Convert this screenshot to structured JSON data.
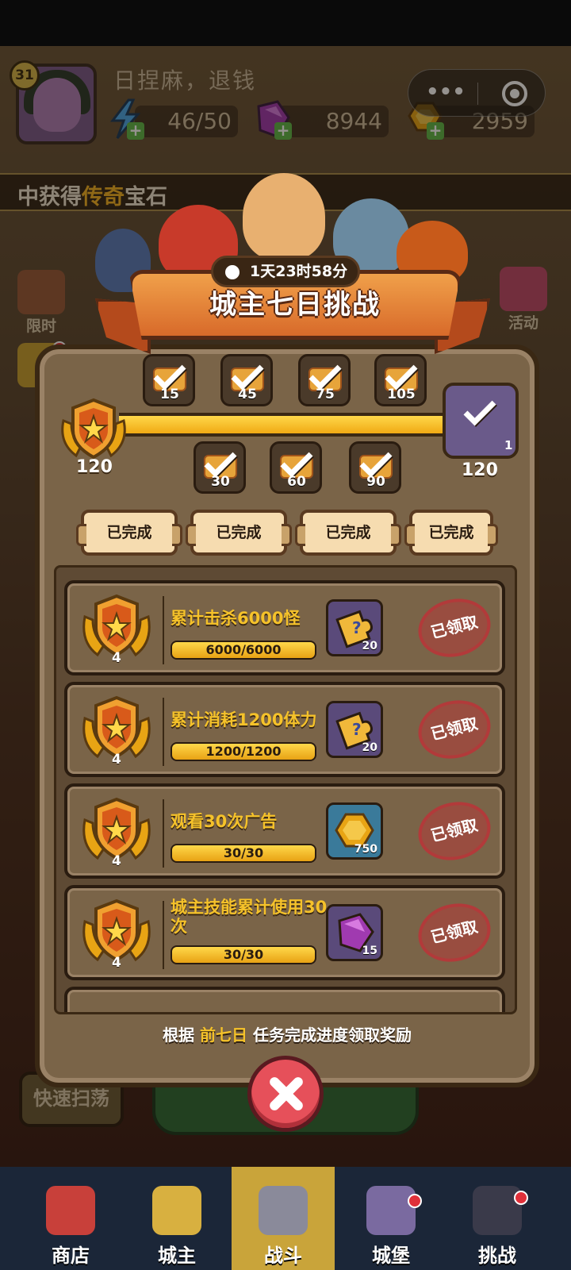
{
  "player": {
    "level": "31",
    "name": "日捏麻，退钱",
    "stamina": "46/50",
    "gems": "8944",
    "gold": "2959"
  },
  "ticker": {
    "prefix": "中获得",
    "highlight": "传奇",
    "suffix": "宝石"
  },
  "side_buttons": {
    "left": [
      "限时"
    ],
    "right": [
      "活动"
    ]
  },
  "challenge": {
    "timer": "1天23时58分",
    "title": "城主七日挑战",
    "current_points": "120",
    "max_points": "120",
    "progress": 1.0,
    "milestones_top": [
      "15",
      "45",
      "75",
      "105"
    ],
    "milestones_bottom": [
      "30",
      "60",
      "90"
    ],
    "final_reward_count": "1",
    "day_tabs": [
      "已完成",
      "已完成",
      "已完成",
      "已完成"
    ]
  },
  "tasks": [
    {
      "medal": "4",
      "title": "累计击杀6000怪",
      "progress_text": "6000/6000",
      "progress": 1.0,
      "reward_icon": "puzzle-fragment-icon",
      "reward_amount": "20",
      "status": "已领取"
    },
    {
      "medal": "4",
      "title": "累计消耗1200体力",
      "progress_text": "1200/1200",
      "progress": 1.0,
      "reward_icon": "puzzle-fragment-icon",
      "reward_amount": "20",
      "status": "已领取"
    },
    {
      "medal": "4",
      "title": "观看30次广告",
      "progress_text": "30/30",
      "progress": 1.0,
      "reward_icon": "gold-coin-icon",
      "reward_amount": "750",
      "status": "已领取"
    },
    {
      "medal": "4",
      "title": "城主技能累计使用30次",
      "progress_text": "30/30",
      "progress": 1.0,
      "reward_icon": "gem-icon",
      "reward_amount": "15",
      "status": "已领取"
    }
  ],
  "footer": {
    "prefix": "根据 ",
    "highlight": "前七日",
    "suffix": " 任务完成进度领取奖励"
  },
  "sweep_button": "快速扫荡",
  "nav": [
    {
      "label": "商店",
      "active": false
    },
    {
      "label": "城主",
      "active": false
    },
    {
      "label": "战斗",
      "active": true
    },
    {
      "label": "城堡",
      "active": false
    },
    {
      "label": "挑战",
      "active": false
    }
  ],
  "colors": {
    "accent_gold": "#f5c22a",
    "progress_fill": "#ffd84a",
    "stamp_red": "#b23a3a",
    "close_red": "#e6505a",
    "nav_bg": "#1b2638"
  }
}
